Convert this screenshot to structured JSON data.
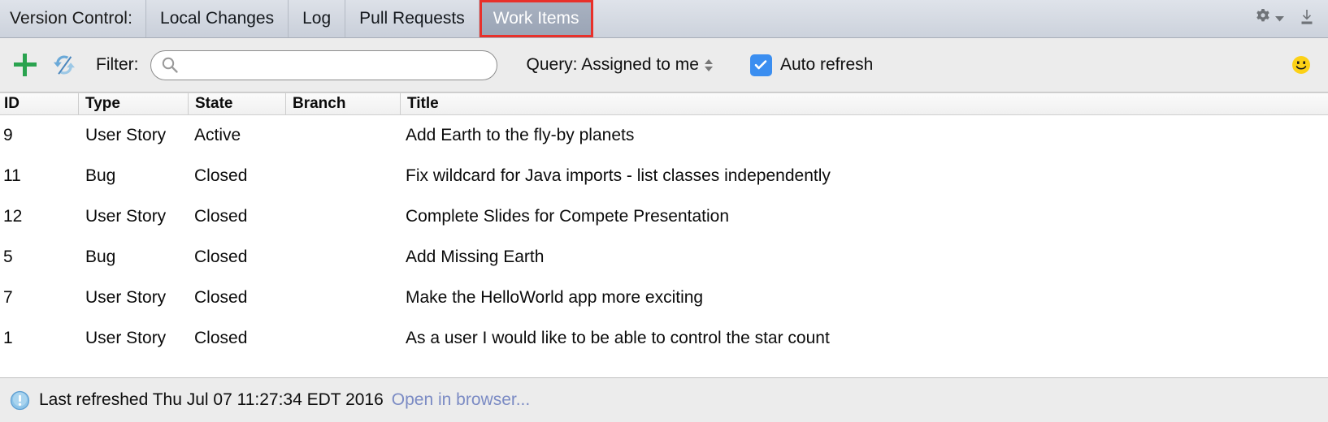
{
  "tabbar": {
    "title": "Version Control:",
    "tabs": [
      {
        "label": "Local Changes",
        "selected": false
      },
      {
        "label": "Log",
        "selected": false
      },
      {
        "label": "Pull Requests",
        "selected": false
      },
      {
        "label": "Work Items",
        "selected": true
      }
    ],
    "icons": {
      "settings": "gear-icon",
      "settings_dropdown": "chevron-down-icon",
      "hide": "hide-window-icon"
    },
    "selected_tab_highlight_color": "#e8302a"
  },
  "toolbar": {
    "add_icon": "plus-icon",
    "refresh_icon": "sync-refresh-icon",
    "filter_label": "Filter:",
    "search": {
      "icon": "search-icon",
      "value": "",
      "placeholder": ""
    },
    "query": {
      "label": "Query: Assigned to me",
      "stepper_icon": "up-down-stepper-icon"
    },
    "auto_refresh": {
      "label": "Auto refresh",
      "checked": true,
      "checkbox_color": "#3b8ef0"
    },
    "status_icon": "smiley-face-icon"
  },
  "table": {
    "columns": [
      "ID",
      "Type",
      "State",
      "Branch",
      "Title"
    ],
    "rows": [
      {
        "id": "9",
        "type": "User Story",
        "state": "Active",
        "branch": "",
        "title": "Add Earth to the fly-by planets"
      },
      {
        "id": "11",
        "type": "Bug",
        "state": "Closed",
        "branch": "",
        "title": "Fix wildcard for Java imports - list classes independently"
      },
      {
        "id": "12",
        "type": "User Story",
        "state": "Closed",
        "branch": "",
        "title": "Complete Slides for Compete Presentation"
      },
      {
        "id": "5",
        "type": "Bug",
        "state": "Closed",
        "branch": "",
        "title": "Add Missing Earth"
      },
      {
        "id": "7",
        "type": "User Story",
        "state": "Closed",
        "branch": "",
        "title": "Make the HelloWorld app more exciting"
      },
      {
        "id": "1",
        "type": "User Story",
        "state": "Closed",
        "branch": "",
        "title": "As a user I would like to be able to control the star count"
      }
    ]
  },
  "statusbar": {
    "icon": "info-icon",
    "text": "Last refreshed Thu Jul 07 11:27:34 EDT 2016",
    "link": "Open in browser..."
  }
}
